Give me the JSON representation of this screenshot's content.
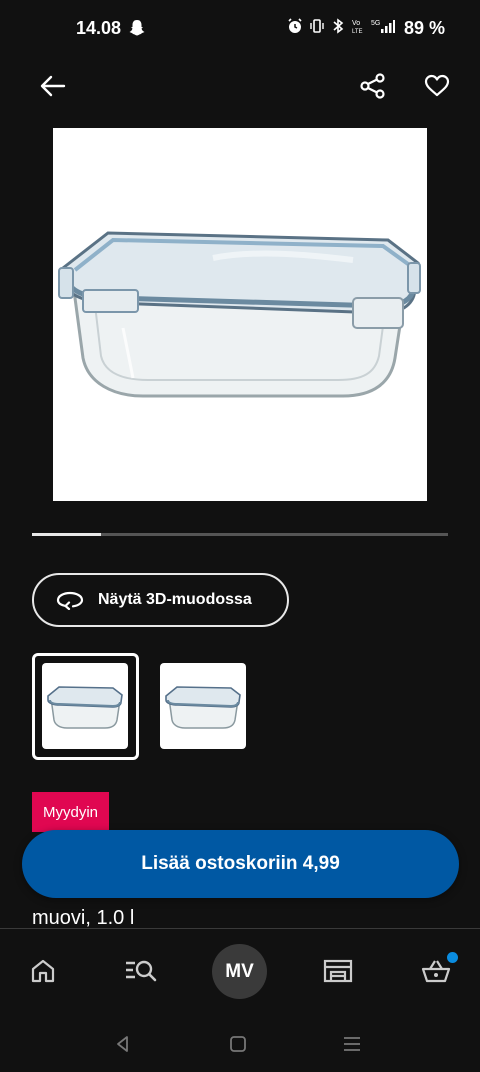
{
  "status_bar": {
    "time": "14.08",
    "battery": "89 %"
  },
  "top_bar": {
    "icons": [
      "back-arrow-icon",
      "share-icon",
      "heart-icon"
    ]
  },
  "carousel": {
    "current": 1,
    "total": 6,
    "progress": 0.166
  },
  "view_3d": {
    "label": "Näytä 3D-muodossa"
  },
  "thumbnails": {
    "count": 2,
    "selected": 1
  },
  "product": {
    "badge": "Myydyin",
    "subtitle": "muovi, 1.0 l"
  },
  "add_to_cart": {
    "label": "Lisää ostoskoriin 4,99"
  },
  "bottom_nav": {
    "account_initials": "MV",
    "items": [
      "home-icon",
      "search-icon",
      "account-avatar",
      "store-icon",
      "cart-icon"
    ],
    "cart_dot_color": "#0a8ce0"
  },
  "colors": {
    "background": "#111111",
    "accent_blue": "#0058a3",
    "badge_red": "#e00751"
  }
}
